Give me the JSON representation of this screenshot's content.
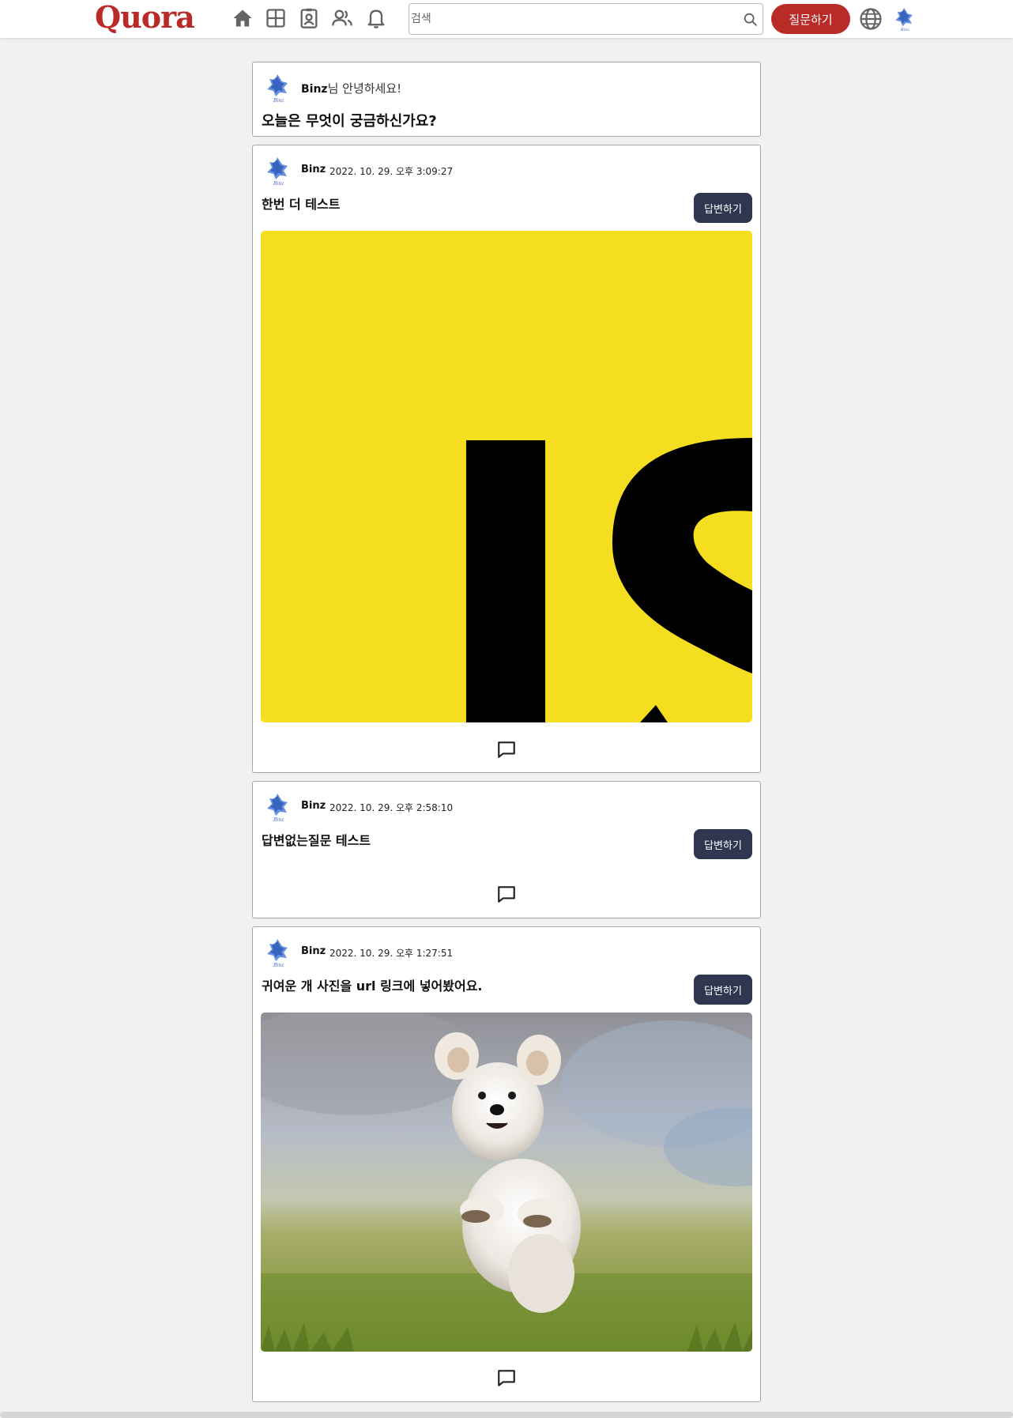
{
  "header": {
    "logo": "Quora",
    "nav_icons": [
      "home-icon",
      "following-icon",
      "spaces-icon",
      "people-icon",
      "notifications-icon"
    ],
    "search": {
      "placeholder": "검색",
      "value": ""
    },
    "ask_button": "질문하기",
    "globe_icon": "globe-icon"
  },
  "greeting": {
    "user": "Binz",
    "suffix": "님 안녕하세요!",
    "question": "오늘은 무엇이 궁금하신가요?"
  },
  "posts": [
    {
      "author": "Binz",
      "timestamp": "2022. 10. 29. 오후 3:09:27",
      "question": "한번 더 테스트",
      "answer_button": "답변하기",
      "image": "js-logo-crop"
    },
    {
      "author": "Binz",
      "timestamp": "2022. 10. 29. 오후 2:58:10",
      "question": "답변없는질문 테스트",
      "answer_button": "답변하기"
    },
    {
      "author": "Binz",
      "timestamp": "2022. 10. 29. 오후 1:27:51",
      "question": "귀여운 개 사진을 url 링크에 넣어봤어요.",
      "answer_button": "답변하기",
      "image": "white-dog-photo"
    }
  ],
  "colors": {
    "brand": "#b92b27",
    "answer_button": "#2e3650",
    "background": "#f1f1f2",
    "js_yellow": "#f5dd1f"
  }
}
